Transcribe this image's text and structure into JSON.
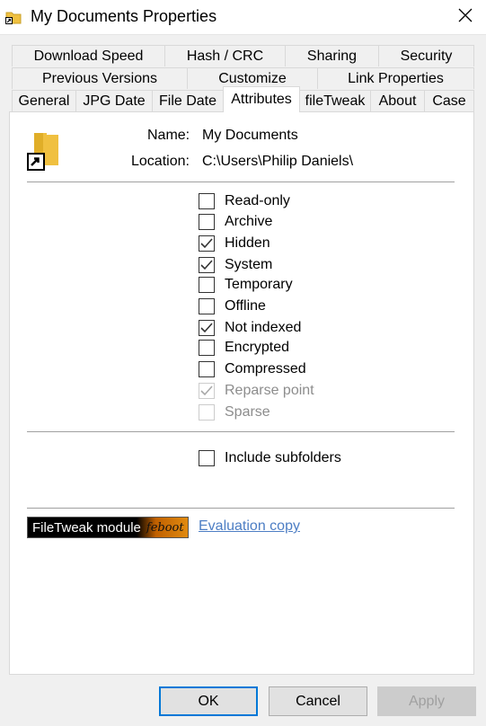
{
  "window": {
    "title": "My Documents Properties",
    "icon": "folder-shortcut-icon",
    "close_icon": "close-icon"
  },
  "tabs": {
    "row1": [
      "Download Speed",
      "Hash / CRC",
      "Sharing",
      "Security"
    ],
    "row2": [
      "Previous Versions",
      "Customize",
      "Link Properties"
    ],
    "row3": [
      "General",
      "JPG Date",
      "File Date",
      "Attributes",
      "fileTweak",
      "About",
      "Case"
    ],
    "active": "Attributes"
  },
  "info": {
    "name_label": "Name:",
    "name_value": "My Documents",
    "location_label": "Location:",
    "location_value": "C:\\Users\\Philip Daniels\\"
  },
  "attributes": [
    {
      "label": "Read-only",
      "checked": false,
      "disabled": false
    },
    {
      "label": "Archive",
      "checked": false,
      "disabled": false
    },
    {
      "label": "Hidden",
      "checked": true,
      "disabled": false
    },
    {
      "label": "System",
      "checked": true,
      "disabled": false
    },
    {
      "label": "Temporary",
      "checked": false,
      "disabled": false
    },
    {
      "label": "Offline",
      "checked": false,
      "disabled": false
    },
    {
      "label": "Not indexed",
      "checked": true,
      "disabled": false
    },
    {
      "label": "Encrypted",
      "checked": false,
      "disabled": false
    },
    {
      "label": "Compressed",
      "checked": false,
      "disabled": false
    },
    {
      "label": "Reparse point",
      "checked": true,
      "disabled": true
    },
    {
      "label": "Sparse",
      "checked": false,
      "disabled": true
    }
  ],
  "include_subfolders": {
    "label": "Include subfolders",
    "checked": false
  },
  "module": {
    "banner_text": "FileTweak module",
    "brand_text": "feboot",
    "link_text": "Evaluation copy"
  },
  "buttons": {
    "ok": "OK",
    "cancel": "Cancel",
    "apply": "Apply"
  },
  "colors": {
    "accent": "#0078d7",
    "link": "#4d7ec4",
    "folder": "#f0c040"
  }
}
